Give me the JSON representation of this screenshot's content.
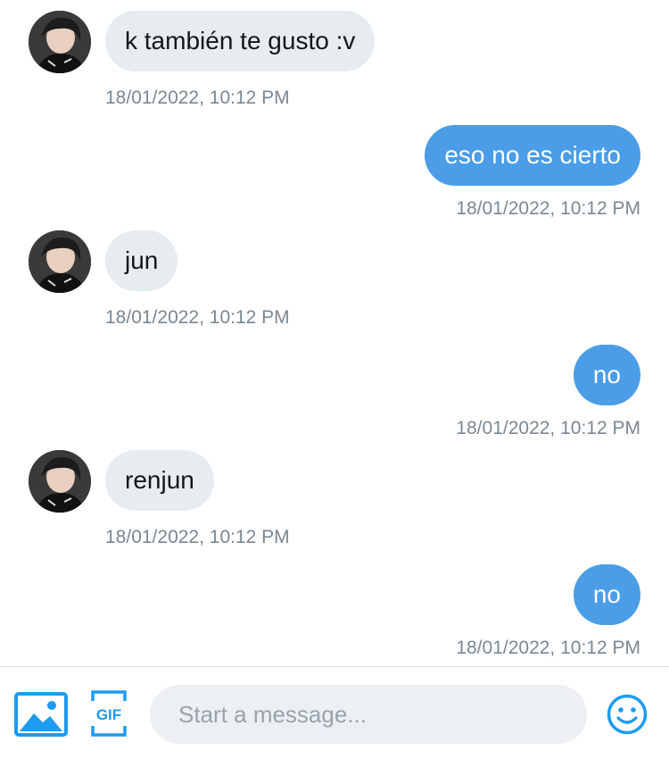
{
  "messages": [
    {
      "direction": "incoming",
      "text": "k también te gusto :v",
      "timestamp": "18/01/2022, 10:12 PM"
    },
    {
      "direction": "outgoing",
      "text": "eso no es cierto",
      "timestamp": "18/01/2022, 10:12 PM"
    },
    {
      "direction": "incoming",
      "text": "jun",
      "timestamp": "18/01/2022, 10:12 PM"
    },
    {
      "direction": "outgoing",
      "text": "no",
      "timestamp": "18/01/2022, 10:12 PM"
    },
    {
      "direction": "incoming",
      "text": "renjun",
      "timestamp": "18/01/2022, 10:12 PM"
    },
    {
      "direction": "outgoing",
      "text": "no",
      "timestamp": "18/01/2022, 10:12 PM"
    }
  ],
  "composer": {
    "placeholder": "Start a message...",
    "media_icon": "image-icon",
    "gif_icon": "gif-icon",
    "gif_label": "GIF",
    "emoji_icon": "emoji-icon"
  },
  "colors": {
    "incoming_bubble": "#e6ecf0",
    "outgoing_bubble": "#4a9de6",
    "accent": "#1da1f2",
    "timestamp": "#7b8791"
  }
}
